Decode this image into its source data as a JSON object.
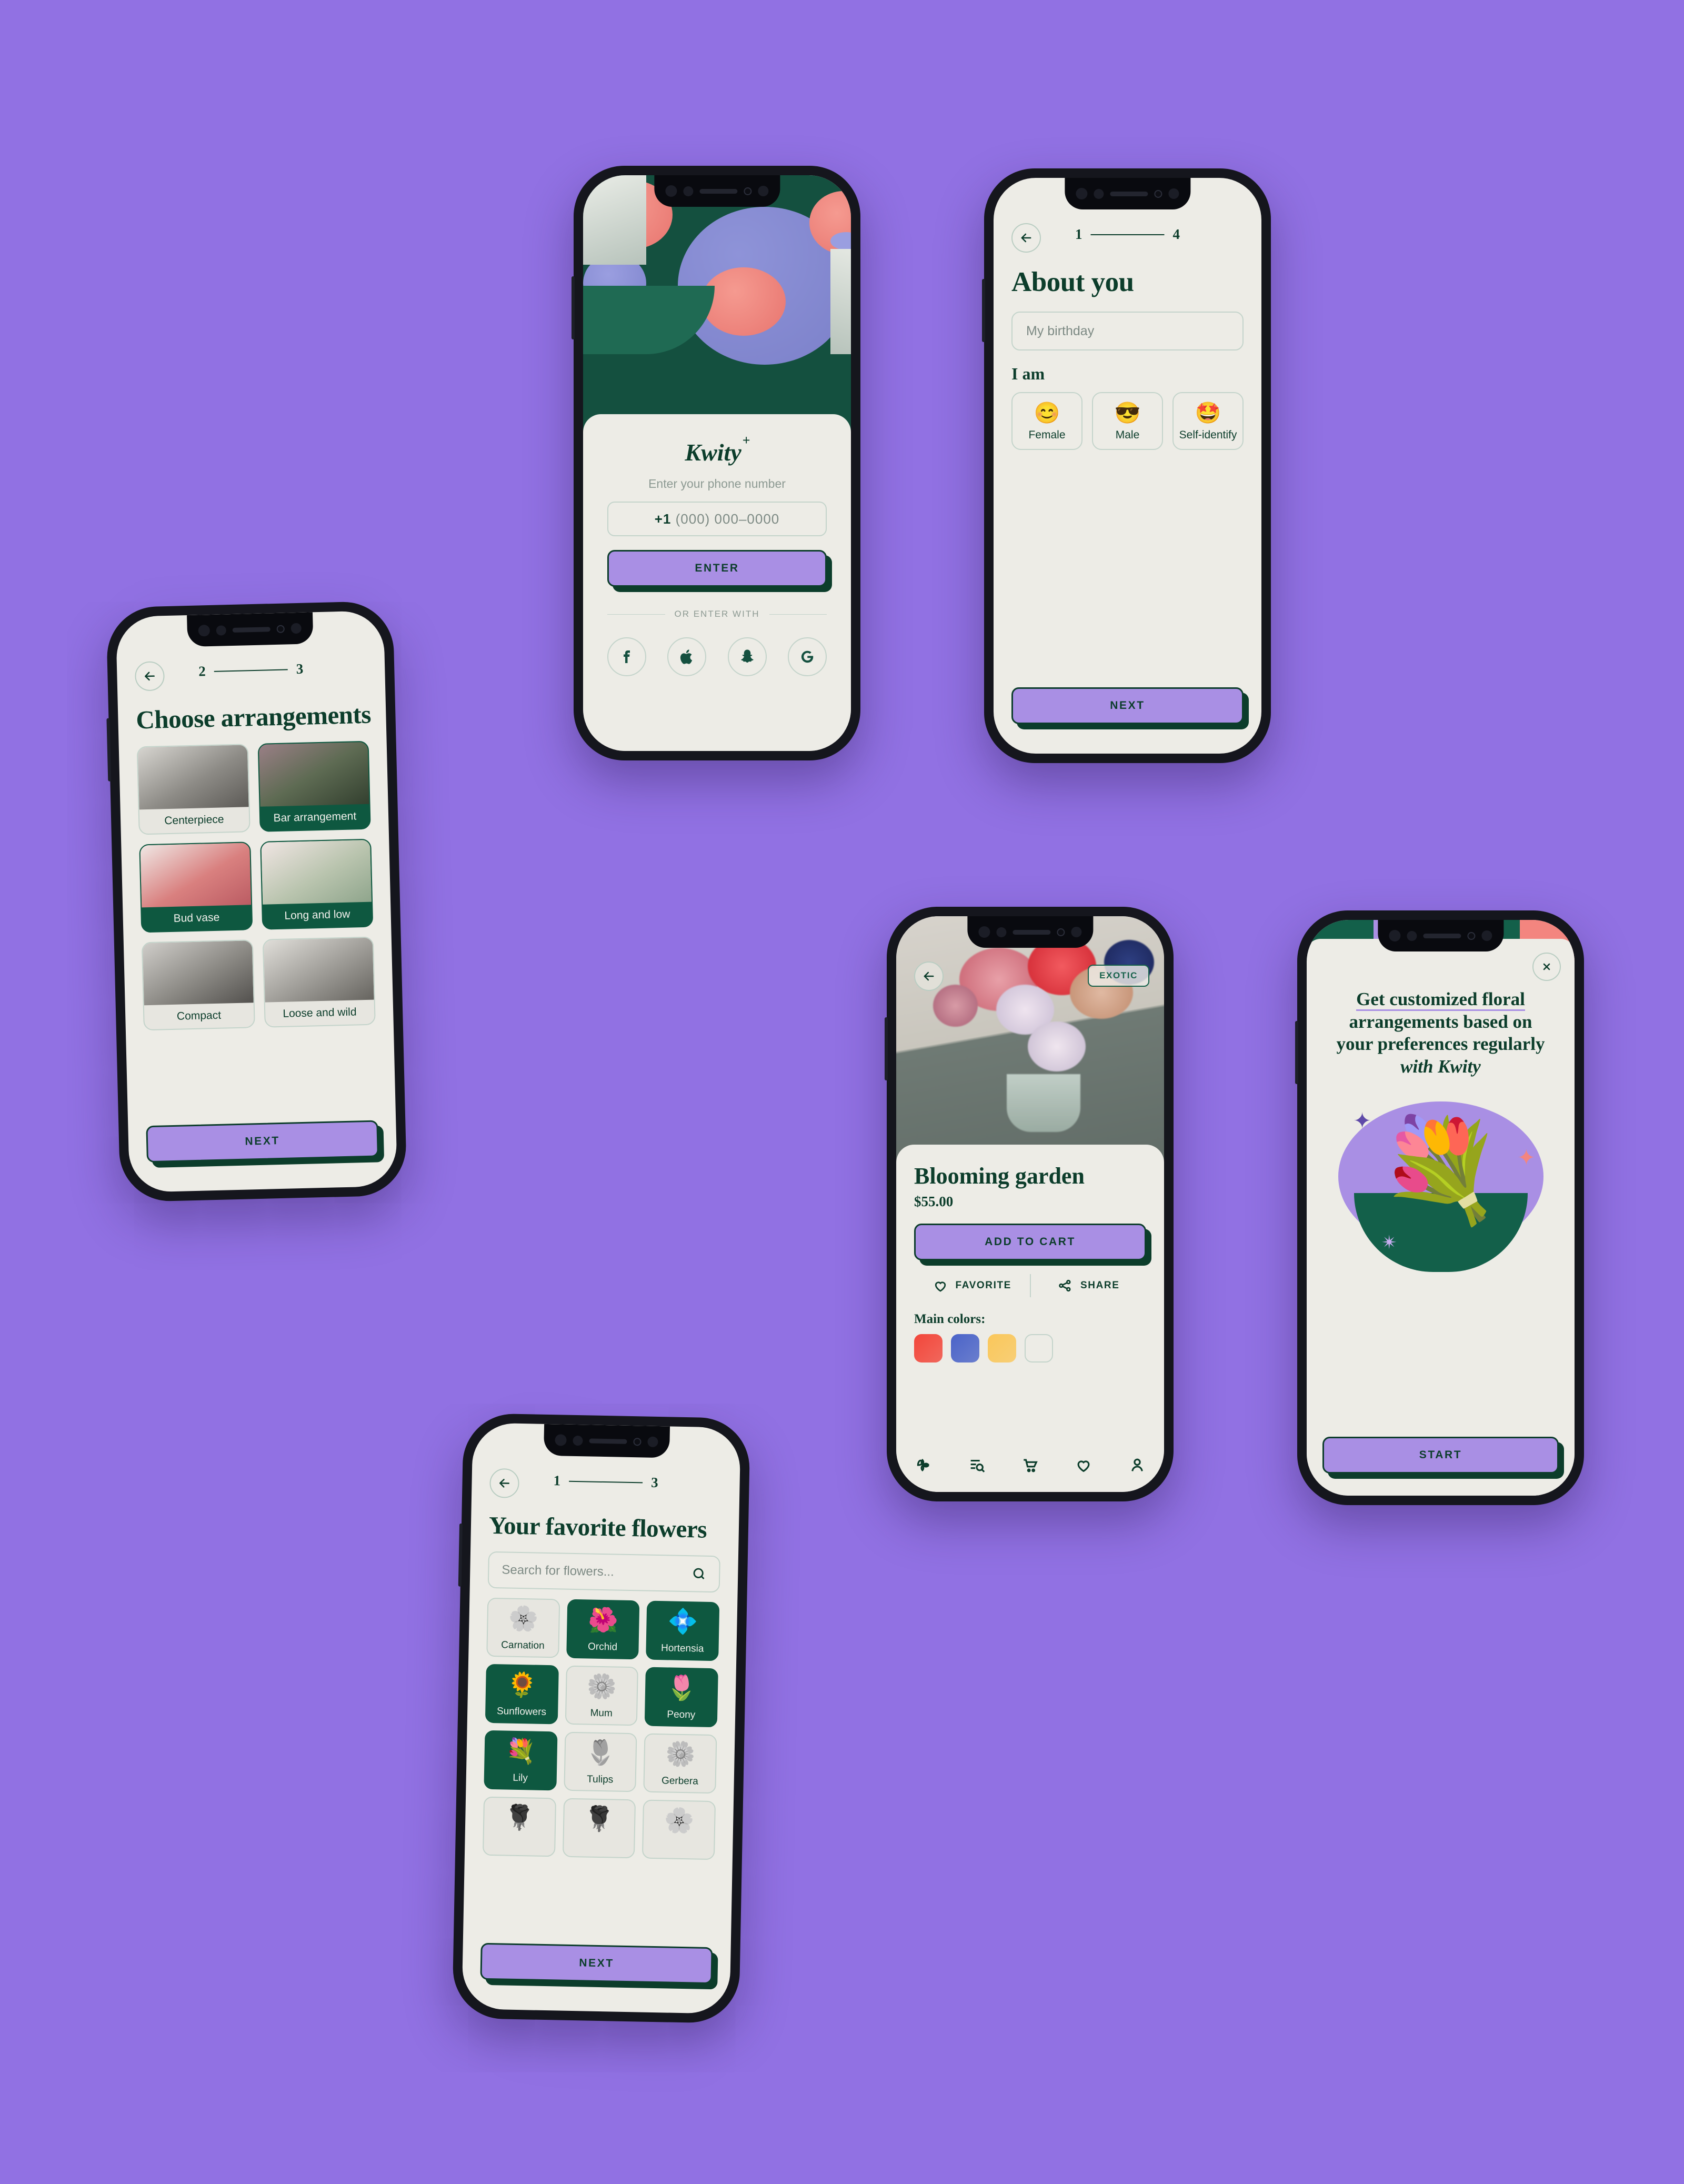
{
  "canvas": {
    "background_color": "#9171e3"
  },
  "brand": {
    "name": "Kwity",
    "mark": "+",
    "accent_purple": "#a98fe4",
    "accent_green": "#0c3d2b",
    "surface": "#edece6"
  },
  "login_screen": {
    "brand_name": "Kwity",
    "brand_mark": "+",
    "prompt": "Enter your phone number",
    "phone_prefix": "+1",
    "phone_placeholder": "(000) 000–0000",
    "enter_button": "ENTER",
    "divider": "OR ENTER WITH",
    "socials": [
      {
        "name": "facebook-icon",
        "label": "Facebook"
      },
      {
        "name": "apple-icon",
        "label": "Apple"
      },
      {
        "name": "snapchat-icon",
        "label": "Snapchat"
      },
      {
        "name": "google-icon",
        "label": "Google"
      }
    ]
  },
  "about_screen": {
    "step_current": "1",
    "step_total": "4",
    "title": "About you",
    "birthday_placeholder": "My birthday",
    "section_label": "I am",
    "options": [
      {
        "emoji": "😊",
        "label": "Female"
      },
      {
        "emoji": "😎",
        "label": "Male"
      },
      {
        "emoji": "🤩",
        "label": "Self-identify"
      }
    ],
    "next_button": "NEXT"
  },
  "arrangements_screen": {
    "step_current": "2",
    "step_total": "3",
    "title": "Choose arrangements",
    "items": [
      {
        "label": "Centerpiece",
        "selected": false,
        "photo": "linear-gradient(150deg,#d6d4cf,#8d8b86 55%,#5d5b57)"
      },
      {
        "label": "Bar arrangement",
        "selected": true,
        "photo": "linear-gradient(150deg,#9a7f86,#5e6b53 50%,#33402f)"
      },
      {
        "label": "Bud vase",
        "selected": true,
        "photo": "linear-gradient(150deg,#efe7e4,#d9807f 55%,#bb5c63)"
      },
      {
        "label": "Long and low",
        "selected": true,
        "photo": "linear-gradient(150deg,#f0e5e3,#b9c4ae 55%,#8fa58c)"
      },
      {
        "label": "Compact",
        "selected": false,
        "photo": "linear-gradient(150deg,#cfcdc9,#8b8984 55%,#53514e)"
      },
      {
        "label": "Loose and wild",
        "selected": false,
        "photo": "linear-gradient(150deg,#e0ded9,#9d9b96 55%,#66645f)"
      }
    ],
    "next_button": "NEXT"
  },
  "flowers_screen": {
    "step_current": "1",
    "step_total": "3",
    "title": "Your favorite flowers",
    "search_placeholder": "Search for flowers...",
    "items": [
      {
        "label": "Carnation",
        "emoji": "🌸",
        "selected": false
      },
      {
        "label": "Orchid",
        "emoji": "🌺",
        "selected": true
      },
      {
        "label": "Hortensia",
        "emoji": "💠",
        "selected": true
      },
      {
        "label": "Sunflowers",
        "emoji": "🌻",
        "selected": true
      },
      {
        "label": "Mum",
        "emoji": "🌼",
        "selected": false
      },
      {
        "label": "Peony",
        "emoji": "🌷",
        "selected": true
      },
      {
        "label": "Lily",
        "emoji": "💐",
        "selected": true
      },
      {
        "label": "Tulips",
        "emoji": "🌷",
        "selected": false
      },
      {
        "label": "Gerbera",
        "emoji": "🌼",
        "selected": false
      },
      {
        "label": "",
        "emoji": "🌹",
        "selected": false
      },
      {
        "label": "",
        "emoji": "🌹",
        "selected": false
      },
      {
        "label": "",
        "emoji": "🌸",
        "selected": false
      }
    ],
    "next_button": "NEXT"
  },
  "product_screen": {
    "badge": "EXOTIC",
    "name": "Blooming garden",
    "price": "$55.00",
    "add_to_cart": "ADD TO CART",
    "favorite": "FAVORITE",
    "share": "SHARE",
    "colors_label": "Main colors:",
    "swatches": [
      "#f2463a",
      "#4a63c8",
      "#fac75a",
      ""
    ],
    "tabs": [
      {
        "name": "home-petal-icon"
      },
      {
        "name": "search-list-icon"
      },
      {
        "name": "cart-icon"
      },
      {
        "name": "heart-icon"
      },
      {
        "name": "profile-icon"
      }
    ]
  },
  "promo_screen": {
    "headline_1": "Get customized floral",
    "headline_2": "arrangements based on",
    "headline_3": "your preferences regularly",
    "headline_4": "with Kwity",
    "start_button": "START"
  }
}
